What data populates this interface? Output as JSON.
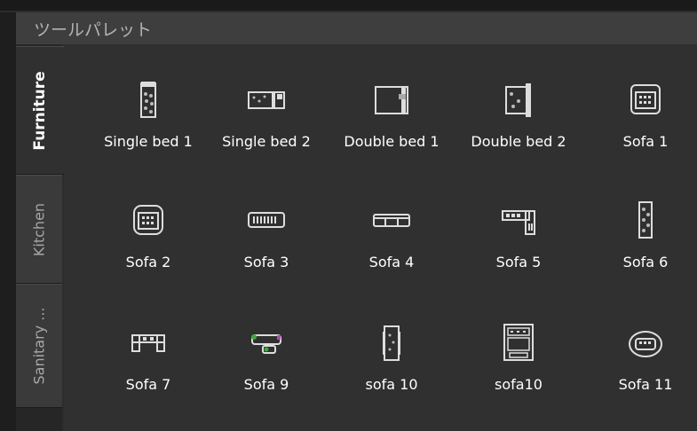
{
  "palette": {
    "title": "ツールパレット",
    "tabs": [
      {
        "label": "Furniture",
        "active": true
      },
      {
        "label": "Kitchen",
        "active": false
      },
      {
        "label": "Sanitary ...",
        "active": false
      }
    ]
  },
  "tools": [
    {
      "label": "Single bed 1",
      "icon": "single-bed-icon"
    },
    {
      "label": "Single bed 2",
      "icon": "single-bed-2-icon"
    },
    {
      "label": "Double bed 1",
      "icon": "double-bed-icon"
    },
    {
      "label": "Double bed 2",
      "icon": "double-bed-2-icon"
    },
    {
      "label": "Sofa 1",
      "icon": "sofa-icon"
    },
    {
      "label": "Sofa 2",
      "icon": "sofa-2-icon"
    },
    {
      "label": "Sofa 3",
      "icon": "sofa-3-icon"
    },
    {
      "label": "Sofa 4",
      "icon": "sofa-4-icon"
    },
    {
      "label": "Sofa 5",
      "icon": "sofa-5-icon"
    },
    {
      "label": "Sofa 6",
      "icon": "sofa-6-icon"
    },
    {
      "label": "Sofa 7",
      "icon": "sofa-7-icon"
    },
    {
      "label": "Sofa 9",
      "icon": "sofa-9-icon"
    },
    {
      "label": "sofa 10",
      "icon": "sofa-10-icon"
    },
    {
      "label": "sofa10",
      "icon": "sofa10-icon"
    },
    {
      "label": "Sofa 11",
      "icon": "sofa-11-icon"
    }
  ]
}
